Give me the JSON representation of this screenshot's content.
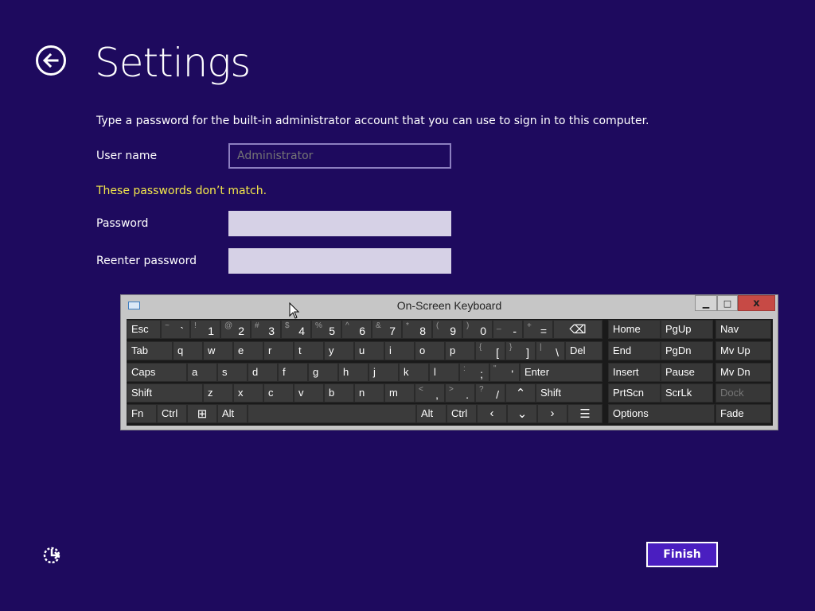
{
  "header": {
    "title": "Settings",
    "back_icon": "back-arrow-circle-icon"
  },
  "form": {
    "instruction": "Type a password for the built-in administrator account that you can use to sign in to this computer.",
    "username_label": "User name",
    "username_placeholder": "Administrator",
    "error": "These passwords don’t match.",
    "password_label": "Password",
    "reenter_label": "Reenter password",
    "error_color": "#f5e94a"
  },
  "osk": {
    "title": "On-Screen Keyboard",
    "minimize": "▁",
    "maximize": "□",
    "close": "x",
    "rows": [
      [
        {
          "main": "Esc"
        },
        {
          "shift": "~",
          "primary": "`"
        },
        {
          "shift": "!",
          "primary": "1"
        },
        {
          "shift": "@",
          "primary": "2"
        },
        {
          "shift": "#",
          "primary": "3"
        },
        {
          "shift": "$",
          "primary": "4"
        },
        {
          "shift": "%",
          "primary": "5"
        },
        {
          "shift": "^",
          "primary": "6"
        },
        {
          "shift": "&",
          "primary": "7"
        },
        {
          "shift": "*",
          "primary": "8"
        },
        {
          "shift": "(",
          "primary": "9"
        },
        {
          "shift": ")",
          "primary": "0"
        },
        {
          "shift": "_",
          "primary": "-"
        },
        {
          "shift": "+",
          "primary": "="
        },
        {
          "center": "⌫",
          "icon": "backspace-icon"
        }
      ],
      [
        {
          "main": "Tab"
        },
        {
          "main": "q"
        },
        {
          "main": "w"
        },
        {
          "main": "e"
        },
        {
          "main": "r"
        },
        {
          "main": "t"
        },
        {
          "main": "y"
        },
        {
          "main": "u"
        },
        {
          "main": "i"
        },
        {
          "main": "o"
        },
        {
          "main": "p"
        },
        {
          "shift": "{",
          "primary": "["
        },
        {
          "shift": "}",
          "primary": "]"
        },
        {
          "shift": "|",
          "primary": "\\"
        },
        {
          "main": "Del"
        }
      ],
      [
        {
          "main": "Caps"
        },
        {
          "main": "a"
        },
        {
          "main": "s"
        },
        {
          "main": "d"
        },
        {
          "main": "f"
        },
        {
          "main": "g"
        },
        {
          "main": "h"
        },
        {
          "main": "j"
        },
        {
          "main": "k"
        },
        {
          "main": "l"
        },
        {
          "shift": ":",
          "primary": ";"
        },
        {
          "shift": "\"",
          "primary": "'"
        },
        {
          "main": "Enter"
        }
      ],
      [
        {
          "main": "Shift"
        },
        {
          "main": "z"
        },
        {
          "main": "x"
        },
        {
          "main": "c"
        },
        {
          "main": "v"
        },
        {
          "main": "b"
        },
        {
          "main": "n"
        },
        {
          "main": "m"
        },
        {
          "shift": "<",
          "primary": ","
        },
        {
          "shift": ">",
          "primary": "."
        },
        {
          "shift": "?",
          "primary": "/"
        },
        {
          "center": "⌃",
          "icon": "arrow-up-icon"
        },
        {
          "main": "Shift"
        }
      ],
      [
        {
          "main": "Fn"
        },
        {
          "main": "Ctrl"
        },
        {
          "center": "⊞",
          "icon": "windows-logo-icon"
        },
        {
          "main": "Alt"
        },
        {
          "main": ""
        },
        {
          "main": "Alt"
        },
        {
          "main": "Ctrl"
        },
        {
          "center": "‹",
          "icon": "arrow-left-icon"
        },
        {
          "center": "⌄",
          "icon": "arrow-down-icon"
        },
        {
          "center": "›",
          "icon": "arrow-right-icon"
        },
        {
          "center": "☰",
          "icon": "context-menu-icon"
        }
      ]
    ],
    "nav_rows": [
      [
        "Home",
        "PgUp",
        "Nav"
      ],
      [
        "End",
        "PgDn",
        "Mv Up"
      ],
      [
        "Insert",
        "Pause",
        "Mv Dn"
      ],
      [
        "PrtScn",
        "ScrLk",
        "Dock"
      ],
      [
        "Options",
        "Fade"
      ]
    ],
    "dimmed": [
      "Dock"
    ]
  },
  "footer": {
    "finish_label": "Finish",
    "ease_icon": "ease-of-access-icon"
  },
  "colors": {
    "background": "#1e0a5e",
    "accent": "#4a1ec0",
    "key": "#3b3b3b"
  }
}
